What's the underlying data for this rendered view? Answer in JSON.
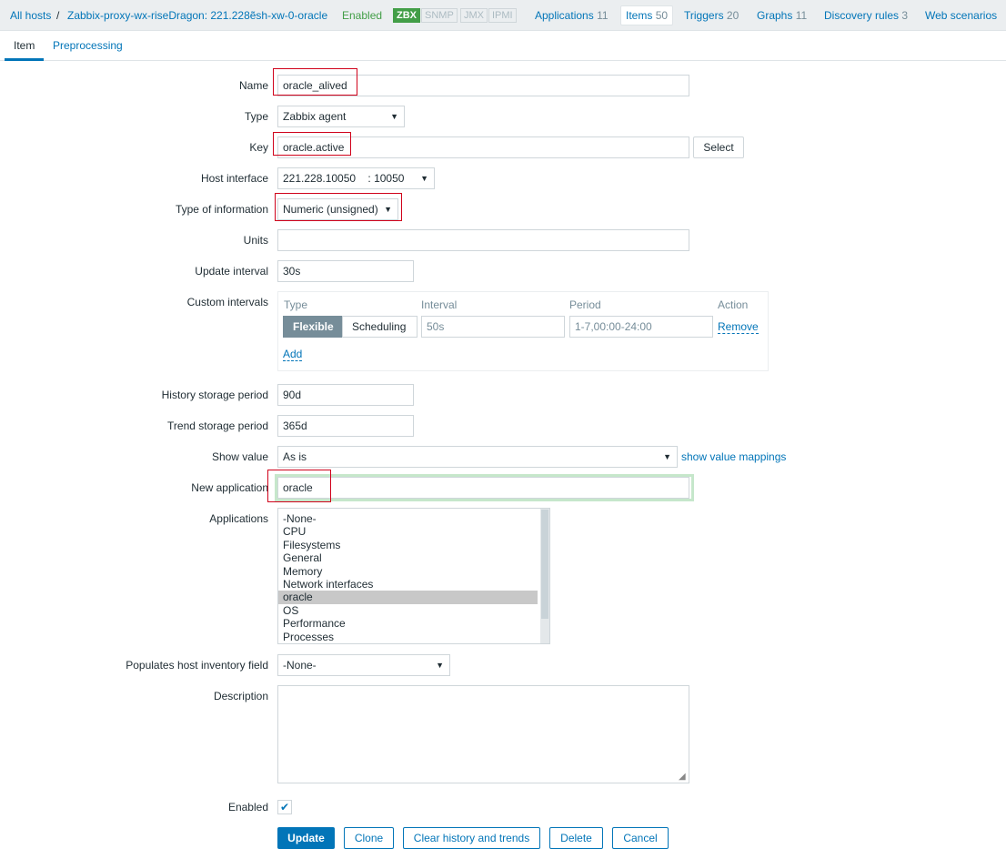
{
  "nav": {
    "all_hosts": "All hosts",
    "separator": "/",
    "host": "Zabbix-proxy-wx-riseDragon: 221.228ẽsh-xw-0-oracle",
    "status": "Enabled",
    "badges": [
      "ZBX",
      "SNMP",
      "JMX",
      "IPMI"
    ],
    "applications": "Applications",
    "applications_count": "11",
    "items": "Items",
    "items_count": "50",
    "triggers": "Triggers",
    "triggers_count": "20",
    "graphs": "Graphs",
    "graphs_count": "11",
    "discovery": "Discovery rules",
    "discovery_count": "3",
    "web": "Web scenarios"
  },
  "tabs": [
    "Item",
    "Preprocessing"
  ],
  "form": {
    "name_label": "Name",
    "name_value": "oracle_alived",
    "type_label": "Type",
    "type_value": "Zabbix agent",
    "key_label": "Key",
    "key_value": "oracle.active",
    "select_button": "Select",
    "iface_label": "Host interface",
    "iface_value": "221.228.10050    : 10050",
    "typeinfo_label": "Type of information",
    "typeinfo_value": "Numeric (unsigned)",
    "units_label": "Units",
    "units_value": "",
    "update_label": "Update interval",
    "update_value": "30s",
    "custom_label": "Custom intervals",
    "custom": {
      "col_type": "Type",
      "col_interval": "Interval",
      "col_period": "Period",
      "col_action": "Action",
      "flexible": "Flexible",
      "scheduling": "Scheduling",
      "interval_value": "50s",
      "period_value": "1-7,00:00-24:00",
      "remove": "Remove",
      "add": "Add"
    },
    "history_label": "History storage period",
    "history_value": "90d",
    "trend_label": "Trend storage period",
    "trend_value": "365d",
    "showvalue_label": "Show value",
    "showvalue_value": "As is",
    "show_mappings": "show value mappings",
    "newapp_label": "New application",
    "newapp_value": "oracle",
    "apps_label": "Applications",
    "apps": [
      "-None-",
      "CPU",
      "Filesystems",
      "General",
      "Memory",
      "Network interfaces",
      "oracle",
      "OS",
      "Performance",
      "Processes"
    ],
    "apps_selected": "oracle",
    "inventory_label": "Populates host inventory field",
    "inventory_value": "-None-",
    "desc_label": "Description",
    "desc_value": "",
    "enabled_label": "Enabled",
    "enabled_check": "✔"
  },
  "buttons": {
    "update": "Update",
    "clone": "Clone",
    "clear": "Clear history and trends",
    "delete": "Delete",
    "cancel": "Cancel"
  }
}
